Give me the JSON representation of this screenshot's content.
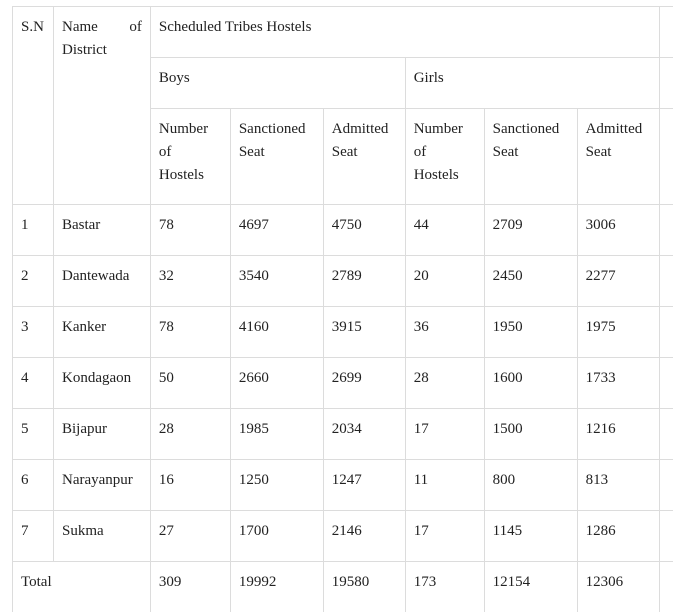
{
  "headers": {
    "sn": "S.N",
    "name_word": "Name",
    "name_of": "of",
    "name_district": "District",
    "group": "Scheduled Tribes Hostels",
    "boys": "Boys",
    "girls": "Girls",
    "number_of_hostels": [
      "Number",
      "of",
      "Hostels"
    ],
    "sanctioned_seat": [
      "Sanctioned",
      "Seat"
    ],
    "admitted_seat": [
      "Admitted",
      "Seat"
    ]
  },
  "rows": [
    {
      "sn": "1",
      "district": "Bastar",
      "boys_hostels": "78",
      "boys_sanctioned": "4697",
      "boys_admitted": "4750",
      "girls_hostels": "44",
      "girls_sanctioned": "2709",
      "girls_admitted": "3006"
    },
    {
      "sn": "2",
      "district": "Dantewada",
      "boys_hostels": "32",
      "boys_sanctioned": "3540",
      "boys_admitted": "2789",
      "girls_hostels": "20",
      "girls_sanctioned": "2450",
      "girls_admitted": "2277"
    },
    {
      "sn": "3",
      "district": "Kanker",
      "boys_hostels": "78",
      "boys_sanctioned": "4160",
      "boys_admitted": "3915",
      "girls_hostels": "36",
      "girls_sanctioned": "1950",
      "girls_admitted": "1975"
    },
    {
      "sn": "4",
      "district": "Kondagaon",
      "boys_hostels": "50",
      "boys_sanctioned": "2660",
      "boys_admitted": "2699",
      "girls_hostels": "28",
      "girls_sanctioned": "1600",
      "girls_admitted": "1733"
    },
    {
      "sn": "5",
      "district": "Bijapur",
      "boys_hostels": "28",
      "boys_sanctioned": "1985",
      "boys_admitted": "2034",
      "girls_hostels": "17",
      "girls_sanctioned": "1500",
      "girls_admitted": "1216"
    },
    {
      "sn": "6",
      "district": "Narayanpur",
      "boys_hostels": "16",
      "boys_sanctioned": "1250",
      "boys_admitted": "1247",
      "girls_hostels": "11",
      "girls_sanctioned": "800",
      "girls_admitted": "813"
    },
    {
      "sn": "7",
      "district": "Sukma",
      "boys_hostels": "27",
      "boys_sanctioned": "1700",
      "boys_admitted": "2146",
      "girls_hostels": "17",
      "girls_sanctioned": "1145",
      "girls_admitted": "1286"
    }
  ],
  "total": {
    "label": "Total",
    "boys_hostels": "309",
    "boys_sanctioned": "19992",
    "boys_admitted": "19580",
    "girls_hostels": "173",
    "girls_sanctioned": "12154",
    "girls_admitted": "12306"
  }
}
